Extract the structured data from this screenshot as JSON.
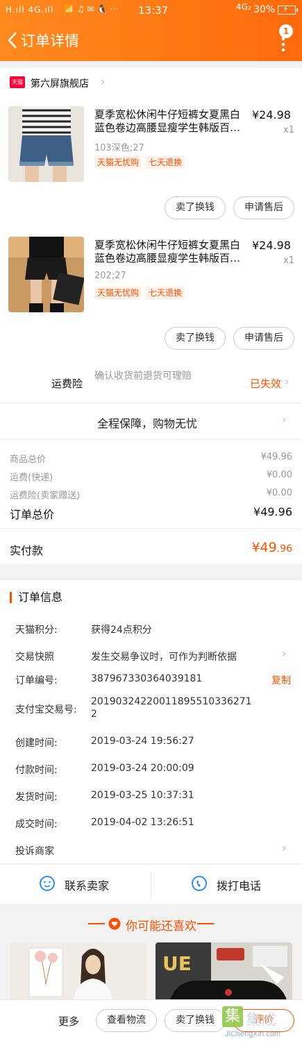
{
  "status_bar": {
    "signal": "H.ıll 4G.ıll",
    "icons": "📶 ♫ ✉ 🐧 ⋯",
    "time": "13:37",
    "network": "4G₂",
    "battery": "30%"
  },
  "header": {
    "title": "订单详情",
    "badge_count": "1"
  },
  "store": {
    "logo_text": "天猫",
    "name": "第六屏旗舰店"
  },
  "items": [
    {
      "title": "夏季宽松休闲牛仔短裤女夏黑白蓝色卷边高腰显瘦学生韩版百…",
      "price": "¥24.98",
      "qty": "x1",
      "sku": "103深色;27",
      "tags": [
        "天猫无忧购",
        "七天退换"
      ],
      "buttons": [
        "卖了换钱",
        "申请售后"
      ]
    },
    {
      "title": "夏季宽松休闲牛仔短裤女夏黑白蓝色卷边高腰显瘦学生韩版百…",
      "price": "¥24.98",
      "qty": "x1",
      "sku": "202;27",
      "tags": [
        "天猫无忧购",
        "七天退换"
      ],
      "buttons": [
        "卖了换钱",
        "申请售后"
      ]
    }
  ],
  "insurance": {
    "label": "运费险",
    "desc": "确认收货前退货可理赔",
    "status": "已失效"
  },
  "guarantee": "全程保障，购物无忧",
  "prices": {
    "goods_label": "商品总价",
    "goods_value": "¥49.96",
    "shipping_label": "运费(快递)",
    "shipping_value": "¥0.00",
    "ins_label": "运费险(卖家赠送)",
    "ins_value": "¥0.00",
    "total_label": "订单总价",
    "total_value": "¥49.96",
    "paid_label": "实付款",
    "paid_big": "¥49",
    "paid_small": ".96"
  },
  "order_info": {
    "title": "订单信息",
    "rows": [
      {
        "label": "天猫积分:",
        "value": "获得24点积分"
      },
      {
        "label": "交易快照",
        "value": "发生交易争议时，可作为判断依据"
      },
      {
        "label": "订单编号:",
        "value": "387967330364039181"
      },
      {
        "label": "支付宝交易号:",
        "value": "20190324220011895510336271"
      },
      {
        "label": "创建时间:",
        "value": "2019-03-24 19:56:27"
      },
      {
        "label": "付款时间:",
        "value": "2019-03-24 20:00:09"
      },
      {
        "label": "发货时间:",
        "value": "2019-03-25 10:37:31"
      },
      {
        "label": "成交时间:",
        "value": "2019-04-02 13:26:51"
      },
      {
        "label": "投诉商家",
        "value": ""
      }
    ],
    "alipay_tail": "2",
    "copy_label": "复制"
  },
  "contact": {
    "seller": "联系卖家",
    "phone": "拨打电话"
  },
  "recommend": {
    "title": "你可能还喜欢"
  },
  "bottom_bar": {
    "more": "更多",
    "buttons": [
      "查看物流",
      "卖了换钱",
      "评价"
    ]
  },
  "watermark": {
    "text": "集成",
    "url": "JiChengXin.com"
  },
  "colors": {
    "accent": "#ff5000",
    "header_start": "#ff8a1e",
    "header_end": "#ff6a0c"
  }
}
